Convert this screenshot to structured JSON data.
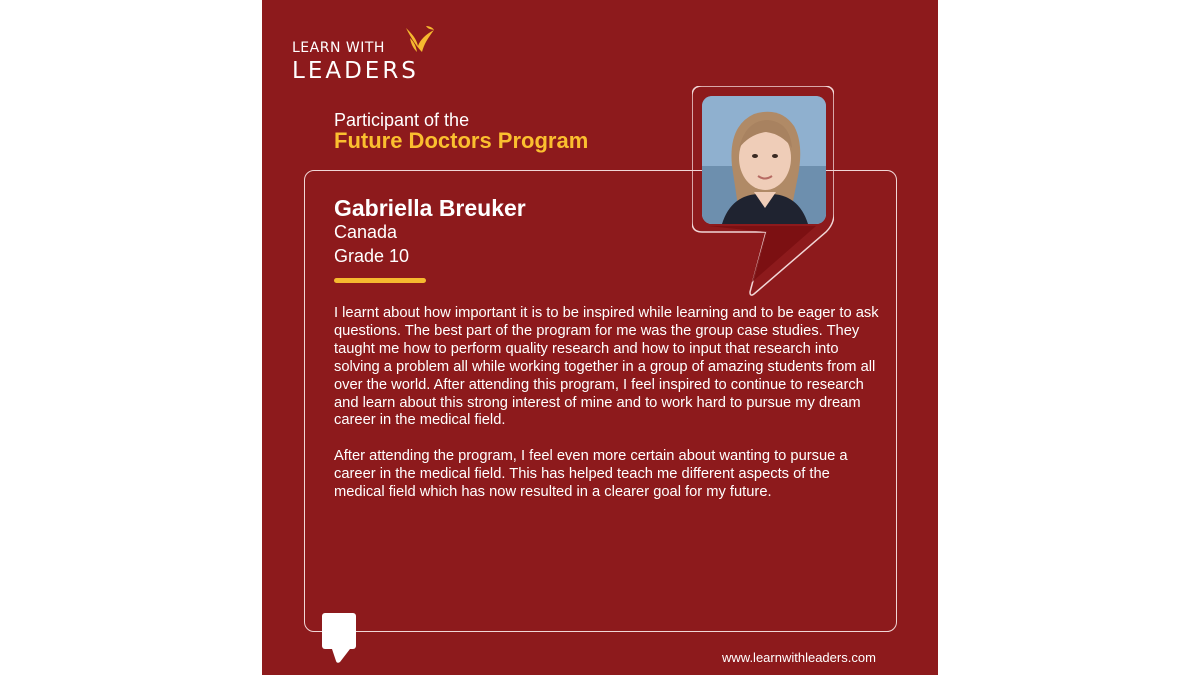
{
  "brand": {
    "logo_top_text": "LEARN WITH",
    "logo_bottom_text": "LEADERS",
    "logo_icon": "bird-icon"
  },
  "header": {
    "subtitle": "Participant of the",
    "program": "Future Doctors Program"
  },
  "participant": {
    "name": "Gabriella Breuker",
    "country": "Canada",
    "grade": "Grade 10"
  },
  "testimonial": {
    "paragraph_1": "I learnt about how important it is to be inspired while learning and to be eager to ask questions. The best part of the program for me was the group case studies. They taught me how to perform quality research and how to input that research into solving a problem all while working together in a group of amazing students from all over the world. After attending this program, I feel inspired to continue to research and learn about this strong interest of mine and to work hard to pursue my dream career in the medical field.",
    "paragraph_2": "After attending the program, I feel even more certain about wanting to pursue a career in the medical field. This has helped teach me different aspects of the medical field which has now resulted in a clearer goal for my future."
  },
  "footer": {
    "website": "www.learnwithleaders.com"
  },
  "colors": {
    "background": "#8d1a1c",
    "accent": "#fbbf2f",
    "text": "#ffffff"
  },
  "icons": {
    "quote": "quote-icon",
    "photo": "participant-photo"
  }
}
